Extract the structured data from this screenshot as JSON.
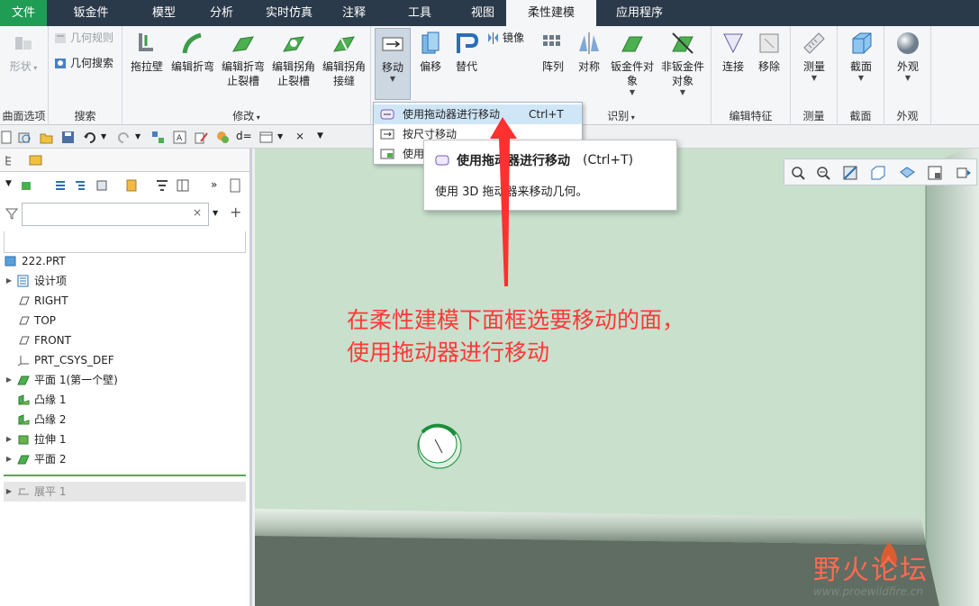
{
  "menu": {
    "tabs": [
      "文件",
      "钣金件",
      "模型",
      "分析",
      "实时仿真",
      "注释",
      "工具",
      "视图",
      "柔性建模",
      "应用程序"
    ],
    "active_index": 8
  },
  "ribbon": {
    "groups": {
      "surface_options": {
        "label": "曲面选项",
        "shape": "形状"
      },
      "search": {
        "label": "搜索",
        "geometry_rules": "几何规则",
        "geometry_search": "几何搜索"
      },
      "modify": {
        "label": "修改",
        "items": [
          "拖拉壁",
          "编辑折弯",
          "编辑折弯止裂槽",
          "编辑拐角止裂槽",
          "编辑拐角接缝"
        ]
      },
      "transform": {
        "move": "移动",
        "offset": "偏移",
        "replace": "替代",
        "mirror": "镜像"
      },
      "identify": {
        "label": "识别",
        "pattern": "阵列",
        "symmetry": "对称",
        "sheetmetal_obj": "钣金件对象",
        "non_sheetmetal_obj": "非钣金件对象"
      },
      "edit_features": {
        "label": "编辑特征",
        "connect": "连接",
        "remove": "移除"
      },
      "measure": {
        "label": "测量",
        "measure": "测量"
      },
      "section": {
        "label": "截面",
        "section": "截面"
      },
      "appearance": {
        "label": "外观",
        "appearance": "外观"
      }
    }
  },
  "move_menu": {
    "items": [
      {
        "label": "使用拖动器进行移动",
        "shortcut": "Ctrl+T",
        "highlighted": true
      },
      {
        "label": "按尺寸移动",
        "shortcut": ""
      },
      {
        "label": "使用",
        "shortcut": ""
      }
    ]
  },
  "tooltip": {
    "title": "使用拖动器进行移动",
    "shortcut": "(Ctrl+T)",
    "description": "使用 3D 拖动器来移动几何。"
  },
  "model_tree": {
    "root": "222.PRT",
    "items": [
      {
        "label": "设计项",
        "expandable": true,
        "icon": "design-items-icon"
      },
      {
        "label": "RIGHT",
        "expandable": false,
        "icon": "datum-plane-icon"
      },
      {
        "label": "TOP",
        "expandable": false,
        "icon": "datum-plane-icon"
      },
      {
        "label": "FRONT",
        "expandable": false,
        "icon": "datum-plane-icon"
      },
      {
        "label": "PRT_CSYS_DEF",
        "expandable": false,
        "icon": "csys-icon"
      },
      {
        "label": "平面 1(第一个壁)",
        "expandable": true,
        "icon": "planar-wall-icon"
      },
      {
        "label": "凸缘 1",
        "expandable": false,
        "icon": "flange-icon"
      },
      {
        "label": "凸缘 2",
        "expandable": false,
        "icon": "flange-icon"
      },
      {
        "label": "拉伸 1",
        "expandable": true,
        "icon": "extrude-icon"
      },
      {
        "label": "平面 2",
        "expandable": true,
        "icon": "planar-wall-icon"
      }
    ],
    "suppressed": "展平 1"
  },
  "search_box": {
    "value": ""
  },
  "annotation": {
    "line1": "在柔性建模下面框选要移动的面，",
    "line2": "使用拖动器进行移动"
  },
  "watermark": {
    "text": "野火论坛",
    "url": "www.proewildfire.cn"
  },
  "colors": {
    "menubar": "#2b3a4a",
    "file_tab": "#1f9d55",
    "canvas": "#c8e0cc",
    "annotation": "#ff3838",
    "highlight": "#cfe6f7"
  }
}
